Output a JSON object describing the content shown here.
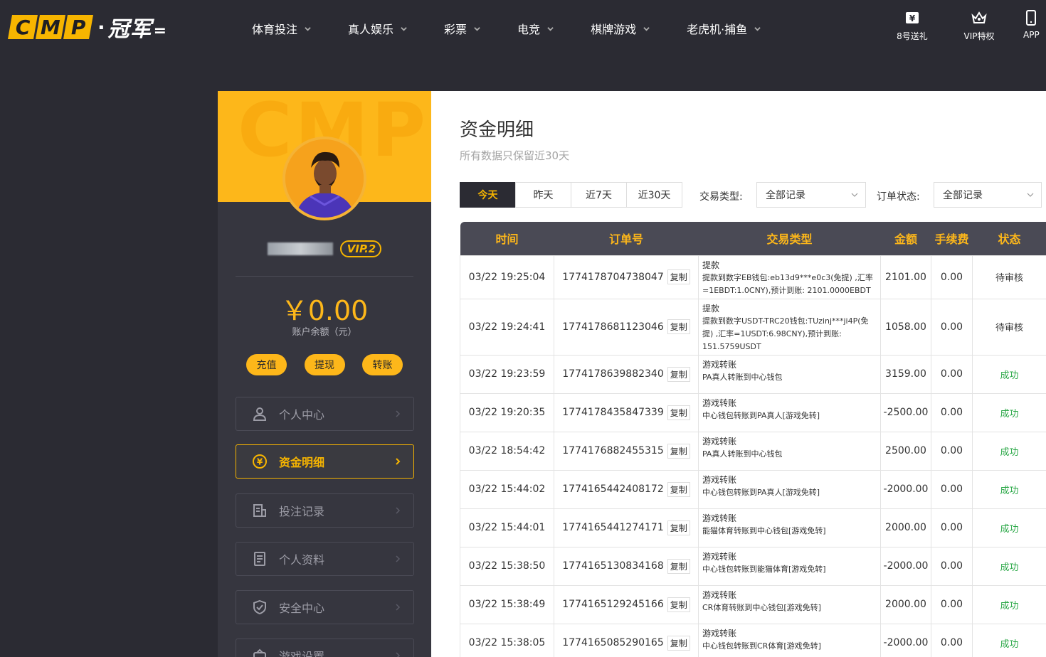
{
  "header": {
    "logo_letters": [
      "C",
      "M",
      "P"
    ],
    "logo_cn": "冠军",
    "nav": [
      {
        "label": "体育投注"
      },
      {
        "label": "真人娱乐"
      },
      {
        "label": "彩票"
      },
      {
        "label": "电竞"
      },
      {
        "label": "棋牌游戏"
      },
      {
        "label": "老虎机·捕鱼"
      }
    ],
    "icons": [
      {
        "name": "ticket-icon",
        "label": "8号送礼"
      },
      {
        "name": "crown-icon",
        "label": "VIP特权"
      },
      {
        "name": "phone-icon",
        "label": "APP"
      }
    ]
  },
  "sidebar": {
    "banner_watermark": "CMP",
    "username": "",
    "vip": "VIP.2",
    "balance": "￥0.00",
    "balance_label": "账户余额（元）",
    "actions": [
      {
        "label": "充值"
      },
      {
        "label": "提现"
      },
      {
        "label": "转账"
      }
    ],
    "menu": [
      {
        "label": "个人中心",
        "icon": "user-icon",
        "active": false
      },
      {
        "label": "资金明细",
        "icon": "yuan-coin-icon",
        "active": true
      },
      {
        "label": "投注记录",
        "icon": "bet-record-icon",
        "active": false
      },
      {
        "label": "个人资料",
        "icon": "profile-doc-icon",
        "active": false
      },
      {
        "label": "安全中心",
        "icon": "shield-icon",
        "active": false
      },
      {
        "label": "游戏设置",
        "icon": "game-settings-icon",
        "active": false
      }
    ]
  },
  "main": {
    "title": "资金明细",
    "subtitle": "所有数据只保留近30天",
    "date_tabs": [
      {
        "label": "今天",
        "active": true
      },
      {
        "label": "昨天",
        "active": false
      },
      {
        "label": "近7天",
        "active": false
      },
      {
        "label": "近30天",
        "active": false
      }
    ],
    "filters": {
      "type_label": "交易类型:",
      "type_value": "全部记录",
      "status_label": "订单状态:",
      "status_value": "全部记录"
    },
    "table": {
      "columns": [
        "时间",
        "订单号",
        "交易类型",
        "金额",
        "手续费",
        "状态"
      ],
      "copy_label": "复制",
      "rows": [
        {
          "time": "03/22 19:25:04",
          "order": "1774178704738047",
          "type": "提款",
          "desc": "提款到数字EB钱包:eb13d9***e0c3(免提) ,汇率=1EBDT:1.0CNY),预计到账: 2101.0000EBDT",
          "amount": "2101.00",
          "fee": "0.00",
          "status": "待审核",
          "ok": false
        },
        {
          "time": "03/22 19:24:41",
          "order": "1774178681123046",
          "type": "提款",
          "desc": "提款到数字USDT-TRC20钱包:TUzinj***ji4P(免提) ,汇率=1USDT:6.98CNY),预计到账: 151.5759USDT",
          "amount": "1058.00",
          "fee": "0.00",
          "status": "待审核",
          "ok": false
        },
        {
          "time": "03/22 19:23:59",
          "order": "1774178639882340",
          "type": "游戏转账",
          "desc": "PA真人转账到中心钱包",
          "amount": "3159.00",
          "fee": "0.00",
          "status": "成功",
          "ok": true
        },
        {
          "time": "03/22 19:20:35",
          "order": "1774178435847339",
          "type": "游戏转账",
          "desc": "中心钱包转账到PA真人[游戏免转]",
          "amount": "-2500.00",
          "fee": "0.00",
          "status": "成功",
          "ok": true
        },
        {
          "time": "03/22 18:54:42",
          "order": "1774176882455315",
          "type": "游戏转账",
          "desc": "PA真人转账到中心钱包",
          "amount": "2500.00",
          "fee": "0.00",
          "status": "成功",
          "ok": true
        },
        {
          "time": "03/22 15:44:02",
          "order": "1774165442408172",
          "type": "游戏转账",
          "desc": "中心钱包转账到PA真人[游戏免转]",
          "amount": "-2000.00",
          "fee": "0.00",
          "status": "成功",
          "ok": true
        },
        {
          "time": "03/22 15:44:01",
          "order": "1774165441274171",
          "type": "游戏转账",
          "desc": "能猫体育转账到中心钱包[游戏免转]",
          "amount": "2000.00",
          "fee": "0.00",
          "status": "成功",
          "ok": true
        },
        {
          "time": "03/22 15:38:50",
          "order": "1774165130834168",
          "type": "游戏转账",
          "desc": "中心钱包转账到能猫体育[游戏免转]",
          "amount": "-2000.00",
          "fee": "0.00",
          "status": "成功",
          "ok": true
        },
        {
          "time": "03/22 15:38:49",
          "order": "1774165129245166",
          "type": "游戏转账",
          "desc": "CR体育转账到中心钱包[游戏免转]",
          "amount": "2000.00",
          "fee": "0.00",
          "status": "成功",
          "ok": true
        },
        {
          "time": "03/22 15:38:05",
          "order": "1774165085290165",
          "type": "游戏转账",
          "desc": "中心钱包转账到CR体育[游戏免转]",
          "amount": "-2000.00",
          "fee": "0.00",
          "status": "成功",
          "ok": true
        }
      ]
    }
  },
  "colors": {
    "brand_yellow": "#fdb71a",
    "dark_bg": "#2b2b33",
    "sidebar_bg": "#36363f",
    "success_green": "#28a745"
  }
}
